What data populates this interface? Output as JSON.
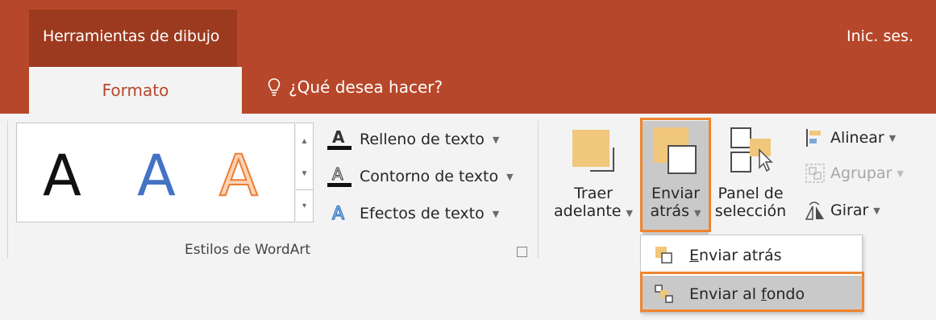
{
  "contextual_tab_group": "Herramientas de dibujo",
  "sign_in": "Inic. ses.",
  "tabs": {
    "active": "Formato",
    "tell_me": "¿Qué desea hacer?"
  },
  "wordart": {
    "gallery_letter": "A",
    "text_fill": "Relleno de texto",
    "text_outline": "Contorno de texto",
    "text_effects": "Efectos de texto",
    "group_label": "Estilos de WordArt"
  },
  "arrange": {
    "bring_forward_line1": "Traer",
    "bring_forward_line2": "adelante",
    "send_backward_line1": "Enviar",
    "send_backward_line2": "atrás",
    "selection_pane_line1": "Panel de",
    "selection_pane_line2": "selección",
    "align": "Alinear",
    "group": "Agrupar",
    "rotate": "Girar"
  },
  "dropdown": {
    "item1_accel": "E",
    "item1_rest": "nviar atrás",
    "item2_pre": "Enviar al ",
    "item2_accel": "f",
    "item2_rest": "ondo"
  },
  "colors": {
    "accent": "#b7472a",
    "highlight": "#f0842e",
    "shape_fill": "#f0c77b"
  }
}
